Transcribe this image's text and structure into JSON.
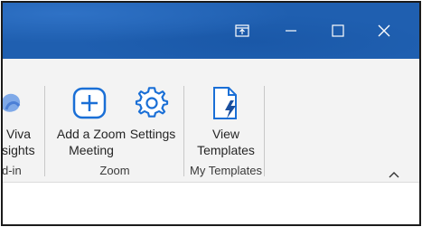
{
  "window_controls": {
    "restore_icon": "window-restore-icon",
    "minimize_icon": "minimize-icon",
    "maximize_icon": "maximize-icon",
    "close_icon": "close-icon"
  },
  "ribbon": {
    "viva": {
      "label_line1": "Viva",
      "label_line2": "sights",
      "group": "d-in"
    },
    "zoom": {
      "add_meeting_line1": "Add a Zoom",
      "add_meeting_line2": "Meeting",
      "settings": "Settings",
      "group": "Zoom"
    },
    "templates": {
      "view_line1": "View",
      "view_line2": "Templates",
      "group": "My Templates"
    },
    "collapse_icon": "chevron-up-icon"
  },
  "colors": {
    "titlebar": "#1f5fb0",
    "accent": "#1a6fd6",
    "ribbon_bg": "#f3f3f3"
  }
}
